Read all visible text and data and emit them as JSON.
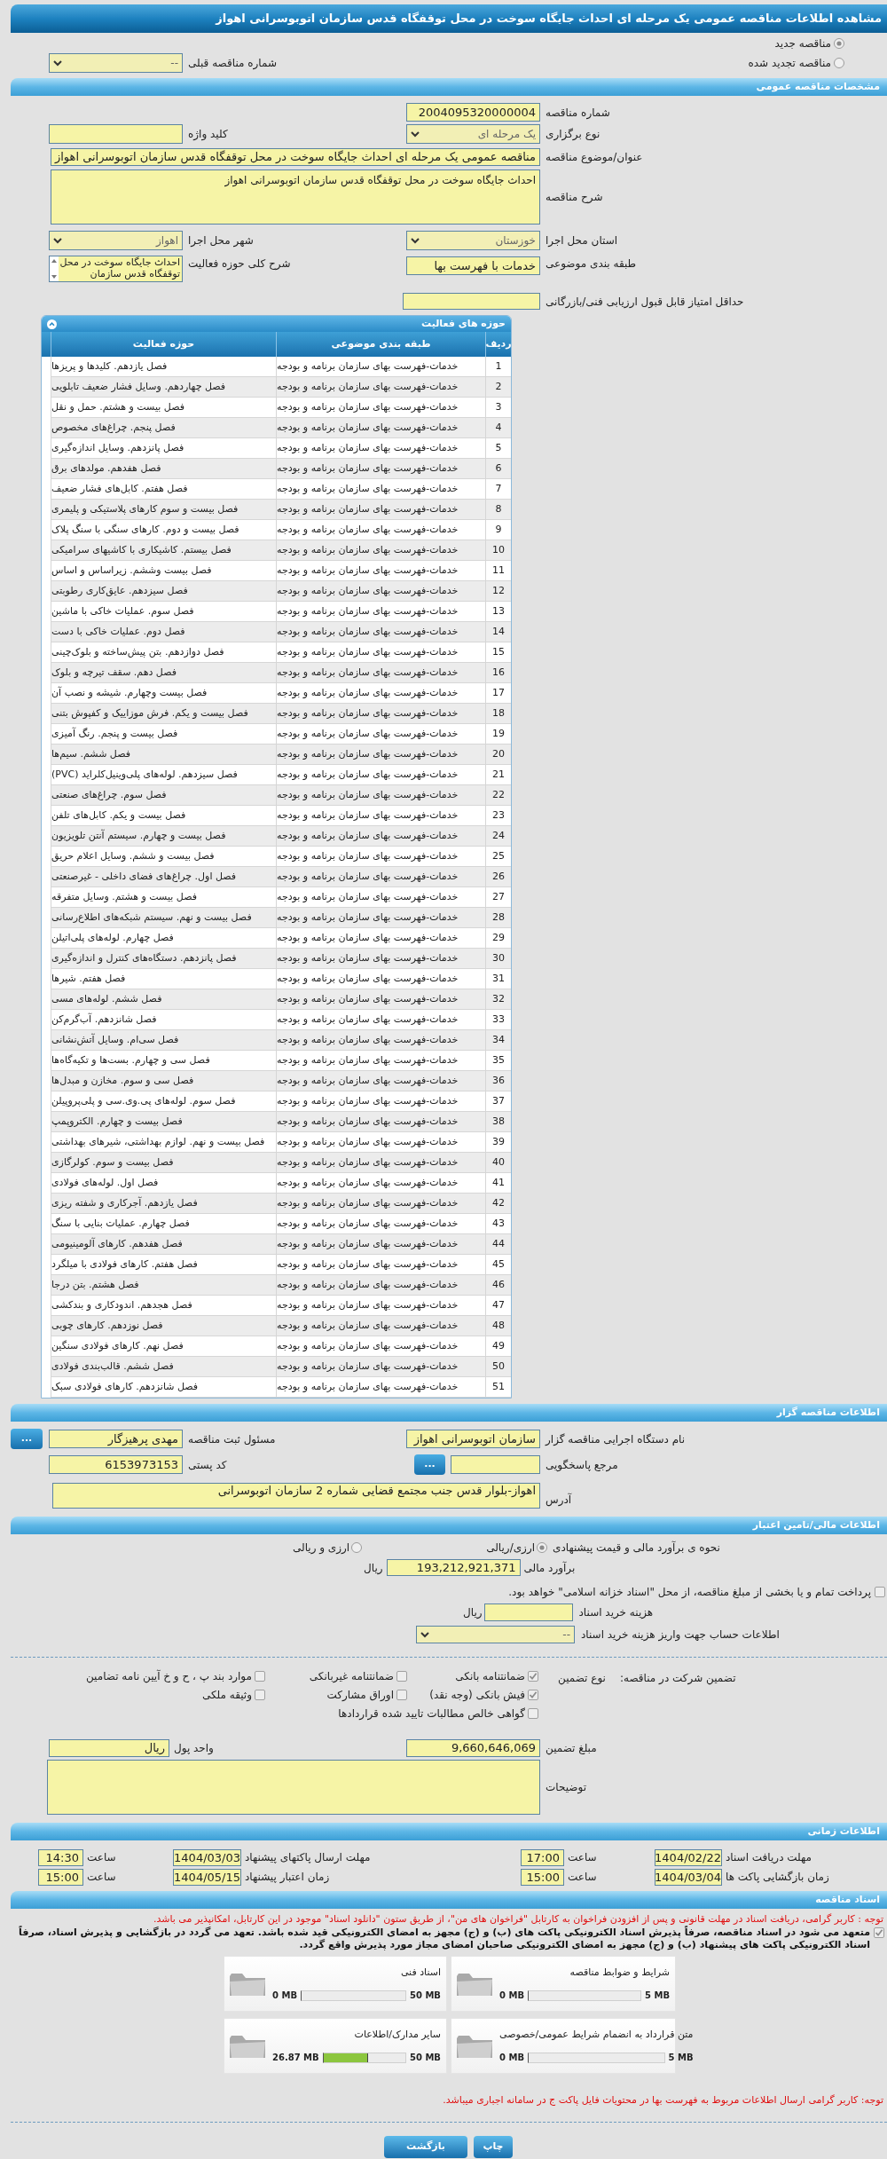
{
  "title": "مشاهده اطلاعات مناقصه عمومی یک مرحله ای احداث جایگاه سوخت در محل توقفگاه قدس سازمان اتوبوسرانی اهواز",
  "tender_status": [
    {
      "label": "مناقصه جدید",
      "selected": true
    },
    {
      "label": "مناقصه تجدید شده",
      "selected": false
    }
  ],
  "previous_tender": {
    "label": "شماره مناقصه قبلی",
    "value": "--"
  },
  "general": {
    "heading": "مشخصات مناقصه عمومی",
    "tender_number": {
      "label": "شماره مناقصه",
      "value": "2004095320000004"
    },
    "holding_type": {
      "label": "نوع برگزاری",
      "value": "یک مرحله ای"
    },
    "keyword": {
      "label": "کلید واژه"
    },
    "subject": {
      "label": "عنوان/موضوع مناقصه",
      "value": "مناقصه عمومی یک مرحله ای احداث جایگاه سوخت در محل توقفگاه قدس سازمان اتوبوسرانی اهواز"
    },
    "description": {
      "label": "شرح مناقصه",
      "value": "احداث جایگاه سوخت در محل توقفگاه قدس سازمان اتوبوسرانی اهواز"
    },
    "province": {
      "label": "استان محل اجرا",
      "value": "خوزستان"
    },
    "city": {
      "label": "شهر محل اجرا",
      "value": "اهواز"
    },
    "category": {
      "label": "طبقه بندی موضوعی",
      "value": "خدمات با فهرست بها"
    },
    "activity_scope": {
      "label": "شرح کلی حوزه فعالیت",
      "value": "احداث جایگاه سوخت در محل توقفگاه قدس سازمان"
    },
    "min_score": {
      "label": "حداقل امتیاز قابل قبول ارزیابی فنی/بازرگانی"
    }
  },
  "activities": {
    "heading": "حوزه های فعالیت",
    "columns": [
      "ردیف",
      "طبقه بندی موضوعی",
      "حوزه فعالیت"
    ],
    "rows": [
      {
        "number": "1",
        "category": "خدمات-فهرست بهای سازمان برنامه و بودجه",
        "activity": "فصل یازدهم. کلیدها و پریزها"
      },
      {
        "number": "2",
        "category": "خدمات-فهرست بهای سازمان برنامه و بودجه",
        "activity": "فصل چهاردهم. وسایل فشار ضعیف تابلویی"
      },
      {
        "number": "3",
        "category": "خدمات-فهرست بهای سازمان برنامه و بودجه",
        "activity": "فصل بیست و هشتم. حمل و نقل"
      },
      {
        "number": "4",
        "category": "خدمات-فهرست بهای سازمان برنامه و بودجه",
        "activity": "فصل پنجم. چراغ‌های مخصوص"
      },
      {
        "number": "5",
        "category": "خدمات-فهرست بهای سازمان برنامه و بودجه",
        "activity": "فصل پانزدهم. وسایل اندازه‌گیری"
      },
      {
        "number": "6",
        "category": "خدمات-فهرست بهای سازمان برنامه و بودجه",
        "activity": "فصل هفدهم. مولدهای برق"
      },
      {
        "number": "7",
        "category": "خدمات-فهرست بهای سازمان برنامه و بودجه",
        "activity": "فصل هفتم. کابل‌های فشار ضعیف"
      },
      {
        "number": "8",
        "category": "خدمات-فهرست بهای سازمان برنامه و بودجه",
        "activity": "فصل بیست و سوم کارهای پلاستیکی و پلیمری"
      },
      {
        "number": "9",
        "category": "خدمات-فهرست بهای سازمان برنامه و بودجه",
        "activity": "فصل بیست و دوم. کارهای سنگی با سنگ پلاک"
      },
      {
        "number": "10",
        "category": "خدمات-فهرست بهای سازمان برنامه و بودجه",
        "activity": "فصل بیستم. کاشیکاری با کاشیهای سرامیکی"
      },
      {
        "number": "11",
        "category": "خدمات-فهرست بهای سازمان برنامه و بودجه",
        "activity": "فصل بیست وششم. زیراساس و اساس"
      },
      {
        "number": "12",
        "category": "خدمات-فهرست بهای سازمان برنامه و بودجه",
        "activity": "فصل سیزدهم. عایق‌کاری رطوبتی"
      },
      {
        "number": "13",
        "category": "خدمات-فهرست بهای سازمان برنامه و بودجه",
        "activity": "فصل سوم. عملیات خاکی با ماشین"
      },
      {
        "number": "14",
        "category": "خدمات-فهرست بهای سازمان برنامه و بودجه",
        "activity": "فصل دوم. عملیات خاکی با دست"
      },
      {
        "number": "15",
        "category": "خدمات-فهرست بهای سازمان برنامه و بودجه",
        "activity": "فصل دوازدهم. بتن پیش‌ساخته و بلوک‌چینی"
      },
      {
        "number": "16",
        "category": "خدمات-فهرست بهای سازمان برنامه و بودجه",
        "activity": "فصل دهم. سقف تیرچه و بلوک"
      },
      {
        "number": "17",
        "category": "خدمات-فهرست بهای سازمان برنامه و بودجه",
        "activity": "فصل بیست وچهارم. شیشه و نصب آن"
      },
      {
        "number": "18",
        "category": "خدمات-فهرست بهای سازمان برنامه و بودجه",
        "activity": "فصل بیست و یکم. فرش موزاییک و کفپوش بتنی"
      },
      {
        "number": "19",
        "category": "خدمات-فهرست بهای سازمان برنامه و بودجه",
        "activity": "فصل بیست و پنجم. رنگ آمیزی"
      },
      {
        "number": "20",
        "category": "خدمات-فهرست بهای سازمان برنامه و بودجه",
        "activity": "فصل ششم. سیم‌ها"
      },
      {
        "number": "21",
        "category": "خدمات-فهرست بهای سازمان برنامه و بودجه",
        "activity": "فصل سیزدهم. لوله‌های پلی‌وینیل‌کلراید (PVC)"
      },
      {
        "number": "22",
        "category": "خدمات-فهرست بهای سازمان برنامه و بودجه",
        "activity": "فصل سوم. چراغ‌های صنعتی"
      },
      {
        "number": "23",
        "category": "خدمات-فهرست بهای سازمان برنامه و بودجه",
        "activity": "فصل بیست و یکم. کابل‌های تلفن"
      },
      {
        "number": "24",
        "category": "خدمات-فهرست بهای سازمان برنامه و بودجه",
        "activity": "فصل بیست و چهارم. سیستم آنتن تلویزیون"
      },
      {
        "number": "25",
        "category": "خدمات-فهرست بهای سازمان برنامه و بودجه",
        "activity": "فصل بیست و ششم. وسایل اعلام حریق"
      },
      {
        "number": "26",
        "category": "خدمات-فهرست بهای سازمان برنامه و بودجه",
        "activity": "فصل اول. چراغ‌های فضای داخلی - غیرصنعتی"
      },
      {
        "number": "27",
        "category": "خدمات-فهرست بهای سازمان برنامه و بودجه",
        "activity": "فصل بیست و هشتم. وسایل متفرقه"
      },
      {
        "number": "28",
        "category": "خدمات-فهرست بهای سازمان برنامه و بودجه",
        "activity": "فصل بیست و نهم. سیستم شبکه‌های اطلاع‌رسانی"
      },
      {
        "number": "29",
        "category": "خدمات-فهرست بهای سازمان برنامه و بودجه",
        "activity": "فصل چهارم. لوله‌های پلی‌اتیلن"
      },
      {
        "number": "30",
        "category": "خدمات-فهرست بهای سازمان برنامه و بودجه",
        "activity": "فصل پانزدهم. دستگاه‌های کنترل و اندازه‌گیری"
      },
      {
        "number": "31",
        "category": "خدمات-فهرست بهای سازمان برنامه و بودجه",
        "activity": "فصل هفتم. شیرها"
      },
      {
        "number": "32",
        "category": "خدمات-فهرست بهای سازمان برنامه و بودجه",
        "activity": "فصل ششم. لوله‌های مسی"
      },
      {
        "number": "33",
        "category": "خدمات-فهرست بهای سازمان برنامه و بودجه",
        "activity": "فصل شانزدهم. آب‌گرم‌کن"
      },
      {
        "number": "34",
        "category": "خدمات-فهرست بهای سازمان برنامه و بودجه",
        "activity": "فصل سی‌ام. وسایل آتش‌نشانی"
      },
      {
        "number": "35",
        "category": "خدمات-فهرست بهای سازمان برنامه و بودجه",
        "activity": "فصل سی و چهارم. بست‌ها و تکیه‌گاه‌ها"
      },
      {
        "number": "36",
        "category": "خدمات-فهرست بهای سازمان برنامه و بودجه",
        "activity": "فصل سی و سوم. مخازن و مبدل‌ها"
      },
      {
        "number": "37",
        "category": "خدمات-فهرست بهای سازمان برنامه و بودجه",
        "activity": "فصل سوم. لوله‌های پی.وی.سی و پلی‌پروپیلن"
      },
      {
        "number": "38",
        "category": "خدمات-فهرست بهای سازمان برنامه و بودجه",
        "activity": "فصل بیست و چهارم. الکتروپمپ"
      },
      {
        "number": "39",
        "category": "خدمات-فهرست بهای سازمان برنامه و بودجه",
        "activity": "فصل بیست و نهم. لوازم بهداشتی، شیرهای بهداشتی"
      },
      {
        "number": "40",
        "category": "خدمات-فهرست بهای سازمان برنامه و بودجه",
        "activity": "فصل بیست و سوم. کولرگازی"
      },
      {
        "number": "41",
        "category": "خدمات-فهرست بهای سازمان برنامه و بودجه",
        "activity": "فصل اول. لوله‌های فولادی"
      },
      {
        "number": "42",
        "category": "خدمات-فهرست بهای سازمان برنامه و بودجه",
        "activity": "فصل یازدهم. آجرکاری و شفته ریزی"
      },
      {
        "number": "43",
        "category": "خدمات-فهرست بهای سازمان برنامه و بودجه",
        "activity": "فصل چهارم. عملیات بنایی با سنگ"
      },
      {
        "number": "44",
        "category": "خدمات-فهرست بهای سازمان برنامه و بودجه",
        "activity": "فصل هفدهم. کارهای آلومینیومی"
      },
      {
        "number": "45",
        "category": "خدمات-فهرست بهای سازمان برنامه و بودجه",
        "activity": "فصل هفتم. کارهای فولادی با میلگرد"
      },
      {
        "number": "46",
        "category": "خدمات-فهرست بهای سازمان برنامه و بودجه",
        "activity": "فصل هشتم. بتن درجا"
      },
      {
        "number": "47",
        "category": "خدمات-فهرست بهای سازمان برنامه و بودجه",
        "activity": "فصل هجدهم. اندودکاری و بندکشی"
      },
      {
        "number": "48",
        "category": "خدمات-فهرست بهای سازمان برنامه و بودجه",
        "activity": "فصل نوزدهم. کارهای چوبی"
      },
      {
        "number": "49",
        "category": "خدمات-فهرست بهای سازمان برنامه و بودجه",
        "activity": "فصل نهم. کارهای فولادی سنگین"
      },
      {
        "number": "50",
        "category": "خدمات-فهرست بهای سازمان برنامه و بودجه",
        "activity": "فصل ششم. قالب‌بندی فولادی"
      },
      {
        "number": "51",
        "category": "خدمات-فهرست بهای سازمان برنامه و بودجه",
        "activity": "فصل شانزدهم. کارهای فولادی سبک"
      }
    ]
  },
  "organizer": {
    "heading": "اطلاعات مناقصه گزار",
    "agency": {
      "label": "نام دستگاه اجرایی مناقصه گزار",
      "value": "سازمان اتوبوسرانی اهواز"
    },
    "registrar": {
      "label": "مسئول ثبت مناقصه",
      "value": "مهدی پرهیزگار",
      "button": "..."
    },
    "contact": {
      "label": "مرجع پاسخگویی",
      "button": "..."
    },
    "postal_code": {
      "label": "کد پستی",
      "value": "6153973153"
    },
    "address": {
      "label": "آدرس",
      "value": "اهواز-بلوار قدس جنب مجتمع قضایی شماره 2 سازمان اتوبوسرانی"
    }
  },
  "finance": {
    "heading": "اطلاعات مالی/تامین اعتبار",
    "price_method": {
      "label": "نحوه ی برآورد مالی و قیمت پیشنهادی",
      "options": [
        {
          "label": "ارزی/ریالی",
          "selected": true
        },
        {
          "label": "ارزی و ریالی",
          "selected": false
        }
      ]
    },
    "estimate": {
      "label": "برآورد مالی",
      "value": "193,212,921,371",
      "unit": "ریال"
    },
    "treasury": {
      "label": "پرداخت تمام و یا بخشی از مبلغ مناقصه، از محل \"اسناد خزانه اسلامی\" خواهد بود.",
      "checked": false
    },
    "document_fee": {
      "label": "هزینه خرید اسناد",
      "unit": "ریال"
    },
    "fee_account": {
      "label": "اطلاعات حساب جهت واریز هزینه خرید اسناد",
      "value": "--"
    }
  },
  "guarantee": {
    "label": "تضمین شرکت در مناقصه:",
    "type_label": "نوع تضمین",
    "options": [
      {
        "label": "ضمانتنامه بانکی",
        "checked": true
      },
      {
        "label": "ضمانتنامه غیربانکی",
        "checked": false
      },
      {
        "label": "موارد بند پ ، ح و خ آیین نامه تضامین",
        "checked": false
      },
      {
        "label": "فیش بانکی (وجه نقد)",
        "checked": true
      },
      {
        "label": "اوراق مشارکت",
        "checked": false
      },
      {
        "label": "وثیقه ملکی",
        "checked": false
      },
      {
        "label": "گواهی خالص مطالبات تایید شده قراردادها",
        "checked": false
      }
    ],
    "amount": {
      "label": "مبلغ تضمین",
      "value": "9,660,646,069"
    },
    "currency": {
      "label": "واحد پول",
      "value": "ریال"
    },
    "notes": {
      "label": "توضیحات"
    }
  },
  "timing": {
    "heading": "اطلاعات زمانی",
    "items": [
      {
        "label": "مهلت دریافت اسناد",
        "date": "1404/02/22",
        "time_label": "ساعت",
        "time": "17:00"
      },
      {
        "label": "مهلت ارسال پاکتهای پیشنهاد",
        "date": "1404/03/03",
        "time_label": "ساعت",
        "time": "14:30"
      },
      {
        "label": "زمان بازگشایی پاکت ها",
        "date": "1404/03/04",
        "time_label": "ساعت",
        "time": "15:00"
      },
      {
        "label": "زمان اعتبار پیشنهاد",
        "date": "1404/05/15",
        "time_label": "ساعت",
        "time": "15:00"
      }
    ]
  },
  "documents": {
    "heading": "اسناد مناقصه",
    "notice": "توجه : کاربر گرامی، دریافت اسناد در مهلت قانونی و پس از افزودن فراخوان به کارتابل \"فراخوان های من\"، از طریق ستون \"دانلود اسناد\" موجود در این کارتابل، امکانپذیر می باشد.",
    "commitment": {
      "text": "متعهد می شود در اسناد مناقصه، صرفاً پذیرش اسناد الکترونیکی پاکت های (ب) و (ج) مجهز به امضای الکترونیکی قید شده باشد. تعهد می گردد در بازگشایی و پذیرش اسناد، صرفاً اسناد الکترونیکی پاکت های پیشنهاد (ب) و (ج) مجهز به امضای الکترونیکی صاحبان امضای مجاز مورد پذیرش واقع گردد.",
      "checked": true
    },
    "folders": [
      {
        "title": "شرایط و ضوابط مناقصه",
        "max": "5 MB",
        "used": "0 MB",
        "level": 0
      },
      {
        "title": "اسناد فنی",
        "max": "50 MB",
        "used": "0 MB",
        "level": 0
      },
      {
        "title": "متن قرارداد به انضمام شرایط عمومی/خصوصی",
        "max": "5 MB",
        "used": "0 MB",
        "level": 0
      },
      {
        "title": "سایر مدارک/اطلاعات",
        "max": "50 MB",
        "used": "26.87 MB",
        "level": 0.54
      }
    ],
    "footnote": "توجه: کاربر گرامی ارسال اطلاعات مربوط به فهرست بها در محتویات فایل پاکت ج در سامانه اجباری میباشد."
  },
  "buttons": [
    "چاپ",
    "بازگشت"
  ]
}
